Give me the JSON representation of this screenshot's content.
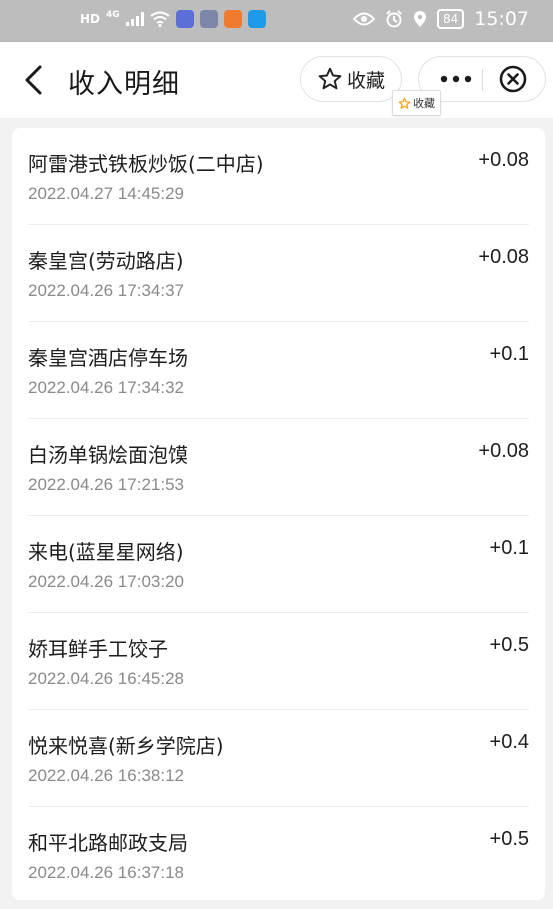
{
  "status_bar": {
    "hd": "HD",
    "network": "4G",
    "battery": "84",
    "time": "15:07"
  },
  "header": {
    "title": "收入明细",
    "favorite_label": "收藏",
    "tooltip_label": "收藏",
    "accent_star_color": "#f5a623"
  },
  "list": {
    "items": [
      {
        "merchant": "阿雷港式铁板炒饭(二中店)",
        "date": "2022.04.27 14:45:29",
        "amount": "+0.08"
      },
      {
        "merchant": "秦皇宫(劳动路店)",
        "date": "2022.04.26 17:34:37",
        "amount": "+0.08"
      },
      {
        "merchant": "秦皇宫酒店停车场",
        "date": "2022.04.26 17:34:32",
        "amount": "+0.1"
      },
      {
        "merchant": "白汤单锅烩面泡馍",
        "date": "2022.04.26 17:21:53",
        "amount": "+0.08"
      },
      {
        "merchant": "来电(蓝星星网络)",
        "date": "2022.04.26 17:03:20",
        "amount": "+0.1"
      },
      {
        "merchant": "娇耳鲜手工饺子",
        "date": "2022.04.26 16:45:28",
        "amount": "+0.5"
      },
      {
        "merchant": "悦来悦喜(新乡学院店)",
        "date": "2022.04.26 16:38:12",
        "amount": "+0.4"
      },
      {
        "merchant": "和平北路邮政支局",
        "date": "2022.04.26 16:37:18",
        "amount": "+0.5"
      }
    ]
  }
}
